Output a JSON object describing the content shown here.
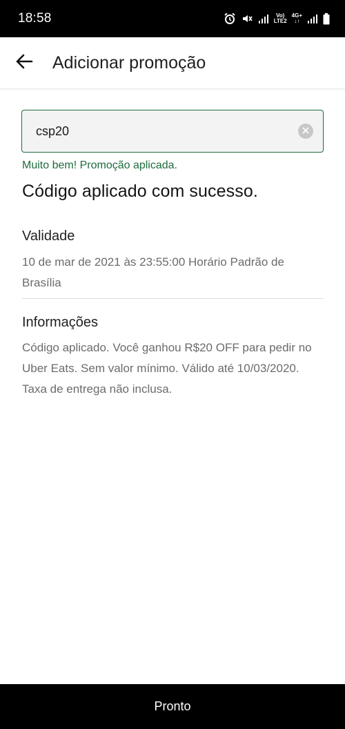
{
  "status_bar": {
    "time": "18:58",
    "icons": [
      "alarm-icon",
      "mute-icon",
      "signal-icon",
      "volte-lte2-icon",
      "4g-data-icon",
      "signal-icon",
      "battery-icon"
    ],
    "volte_line1": "Vo)",
    "volte_line2": "LTE2",
    "net_line1": "4G+",
    "net_line2": "↓↑"
  },
  "header": {
    "title": "Adicionar promoção",
    "back_icon": "arrow-left-icon"
  },
  "promo": {
    "value": "csp20",
    "clear_icon": "clear-icon",
    "success_message": "Muito bem! Promoção aplicada."
  },
  "heading": "Código aplicado com sucesso.",
  "validity": {
    "label": "Validade",
    "text": "10 de mar de 2021 às 23:55:00 Horário Padrão de Brasília"
  },
  "info": {
    "label": "Informações",
    "text": "Código aplicado. Você ganhou R$20 OFF para pedir no Uber Eats. Sem valor mínimo. Válido até 10/03/2020. Taxa de entrega não inclusa."
  },
  "done_button": {
    "label": "Pronto"
  },
  "colors": {
    "accent_green": "#1e6b3c",
    "status_bar_bg": "#000000",
    "button_bg": "#000000"
  }
}
